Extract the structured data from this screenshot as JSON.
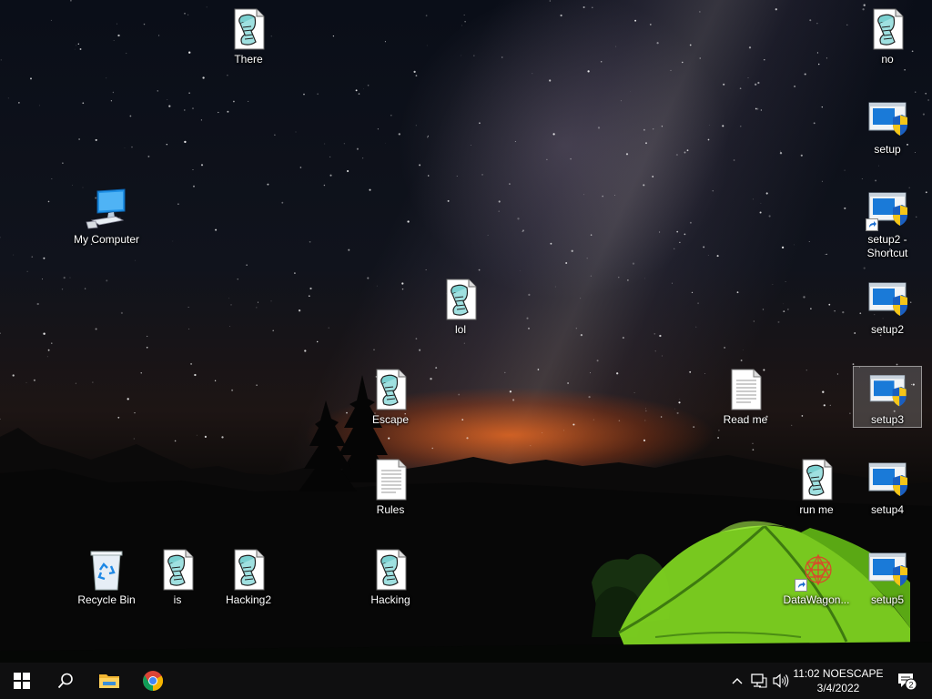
{
  "desktop": {
    "icons": {
      "there": "There",
      "my_computer": "My Computer",
      "lol": "lol",
      "escape": "Escape",
      "rules": "Rules",
      "recycle_bin": "Recycle Bin",
      "is": "is",
      "hacking2": "Hacking2",
      "hacking": "Hacking",
      "read_me": "Read me",
      "run_me": "run me",
      "datawagon": "DataWagon...",
      "no": "no",
      "setup": "setup",
      "setup2_shortcut": "setup2 - Shortcut",
      "setup2": "setup2",
      "setup3": "setup3",
      "setup4": "setup4",
      "setup5": "setup5"
    },
    "selected_icon": "setup3"
  },
  "taskbar": {
    "clock": {
      "time": "11:02 NOESCAPE",
      "date": "3/4/2022"
    },
    "notifications": {
      "count": "2"
    },
    "icons": [
      "windows-start-icon",
      "search-icon",
      "file-explorer-icon",
      "chrome-icon",
      "chevron-up-icon",
      "network-icon",
      "volume-icon",
      "action-center-icon"
    ]
  },
  "colors": {
    "taskbar": "#0f0f10",
    "tent": "#7ed321",
    "sunset": "#ff6e1e"
  }
}
